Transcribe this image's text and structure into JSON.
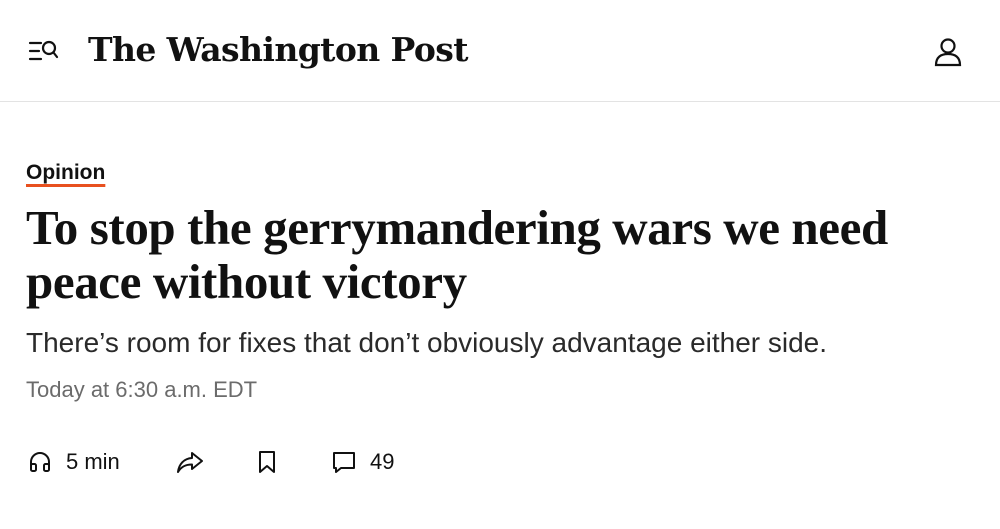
{
  "header": {
    "menu_icon": "menu-search-icon",
    "logo_text": "The Washington Post",
    "account_icon": "account-icon"
  },
  "article": {
    "section_label": "Opinion",
    "headline": "To stop the gerrymandering wars we need peace without victory",
    "subheadline": "There’s room for fixes that don’t obviously advantage either side.",
    "timestamp": "Today at 6:30 a.m. EDT"
  },
  "actions": {
    "listen": {
      "icon": "headphones-icon",
      "label": "5 min"
    },
    "share": {
      "icon": "share-icon"
    },
    "save": {
      "icon": "bookmark-icon"
    },
    "comments": {
      "icon": "comment-icon",
      "count": "49"
    }
  },
  "colors": {
    "accent_underline": "#e8501f",
    "divider": "#e3e3e3",
    "timestamp_gray": "#6b6b6b"
  }
}
